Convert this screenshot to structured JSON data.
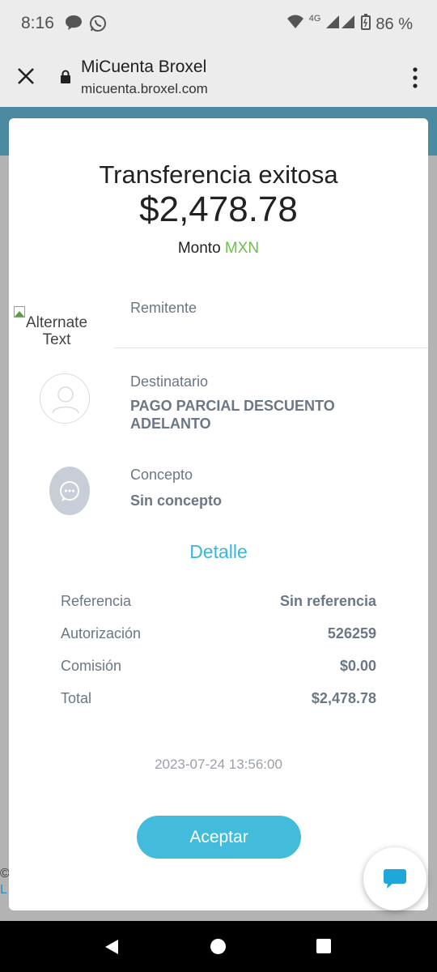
{
  "status_bar": {
    "time": "8:16",
    "network": "4G",
    "battery": "86 %"
  },
  "browser": {
    "title": "MiCuenta Broxel",
    "url": "micuenta.broxel.com"
  },
  "background": {
    "copyright_fragment": "©",
    "link_fragment": "L"
  },
  "receipt": {
    "title": "Transferencia exitosa",
    "amount": "$2,478.78",
    "monto_label": "Monto",
    "currency": "MXN",
    "sender": {
      "image_alt": "Alternate Text",
      "label": "Remitente"
    },
    "recipient": {
      "label": "Destinatario",
      "value": "PAGO PARCIAL DESCUENTO ADELANTO"
    },
    "concept": {
      "label": "Concepto",
      "value": "Sin concepto"
    },
    "detail_title": "Detalle",
    "details": [
      {
        "label": "Referencia",
        "value": "Sin referencia"
      },
      {
        "label": "Autorización",
        "value": "526259"
      },
      {
        "label": "Comisión",
        "value": "$0.00"
      },
      {
        "label": "Total",
        "value": "$2,478.78"
      }
    ],
    "timestamp": "2023-07-24 13:56:00",
    "accept_button": "Aceptar"
  },
  "colors": {
    "accent": "#43bcdc",
    "currency": "#6cc04a",
    "header_teal": "#4b8ba0"
  },
  "icons": [
    "chat-bubble-icon",
    "whatsapp-icon",
    "wifi-icon",
    "signal-icon",
    "battery-icon",
    "close-icon",
    "lock-icon",
    "more-vert-icon",
    "user-avatar-icon",
    "chat-dots-icon",
    "chat-fab-icon",
    "back-icon",
    "home-icon",
    "recents-icon"
  ]
}
